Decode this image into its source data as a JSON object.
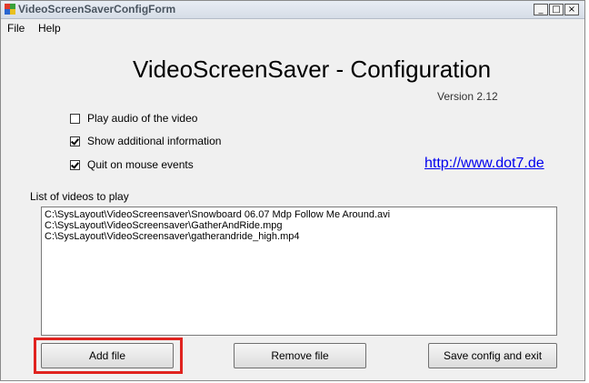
{
  "window": {
    "title": "VideoScreenSaverConfigForm",
    "controls": {
      "minimize": "_",
      "maximize": "□",
      "close": "×"
    }
  },
  "menu": {
    "file": "File",
    "help": "Help"
  },
  "header": {
    "title": "VideoScreenSaver - Configuration",
    "version": "Version 2.12"
  },
  "options": {
    "play_audio": {
      "label": "Play audio of the video",
      "checked": false
    },
    "show_info": {
      "label": "Show additional information",
      "checked": true
    },
    "quit_mouse": {
      "label": "Quit on mouse events",
      "checked": true
    }
  },
  "link": "http://www.dot7.de",
  "videos": {
    "label": "List of videos to play",
    "items": [
      "C:\\SysLayout\\VideoScreensaver\\Snowboard 06.07 Mdp Follow Me Around.avi",
      "C:\\SysLayout\\VideoScreensaver\\GatherAndRide.mpg",
      "C:\\SysLayout\\VideoScreensaver\\gatherandride_high.mp4"
    ]
  },
  "buttons": {
    "add": "Add file",
    "remove": "Remove file",
    "save": "Save config and exit"
  },
  "colors": {
    "highlight": "#e0231f",
    "link": "#0000ee"
  }
}
